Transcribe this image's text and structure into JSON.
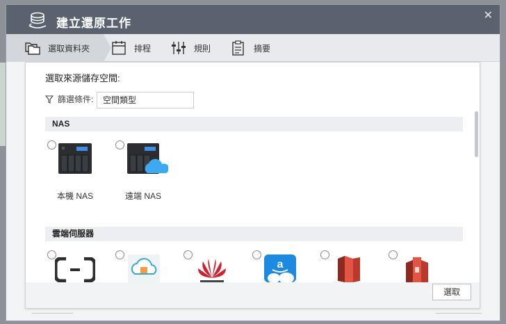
{
  "window": {
    "title": "建立還原工作"
  },
  "steps": [
    {
      "label": "選取資料夾",
      "icon": "folders-icon",
      "active": true
    },
    {
      "label": "排程",
      "icon": "calendar-icon"
    },
    {
      "label": "規則",
      "icon": "sliders-icon"
    },
    {
      "label": "摘要",
      "icon": "clipboard-icon"
    }
  ],
  "panel": {
    "heading": "選取來源儲存空間:",
    "filter_label": "篩選條件:",
    "filter_value": "空間類型"
  },
  "sections": {
    "nas": "NAS",
    "cloud": "雲端伺服器"
  },
  "nas_items": [
    {
      "label": "本機 NAS",
      "icon": "local-nas-icon"
    },
    {
      "label": "遠端 NAS",
      "icon": "remote-nas-icon"
    }
  ],
  "cloud_items": [
    {
      "icon": "alibaba-cloud-icon"
    },
    {
      "icon": "cloud-box-icon"
    },
    {
      "icon": "huawei-icon"
    },
    {
      "icon": "amazon-drive-icon"
    },
    {
      "icon": "amazon-s3-icon"
    },
    {
      "icon": "amazon-glacier-icon"
    }
  ],
  "footer": {
    "select_label": "選取"
  },
  "colors": {
    "titlebar": "#5a6270",
    "step_active": "#d3d6db",
    "section_bg": "#eceef1"
  }
}
